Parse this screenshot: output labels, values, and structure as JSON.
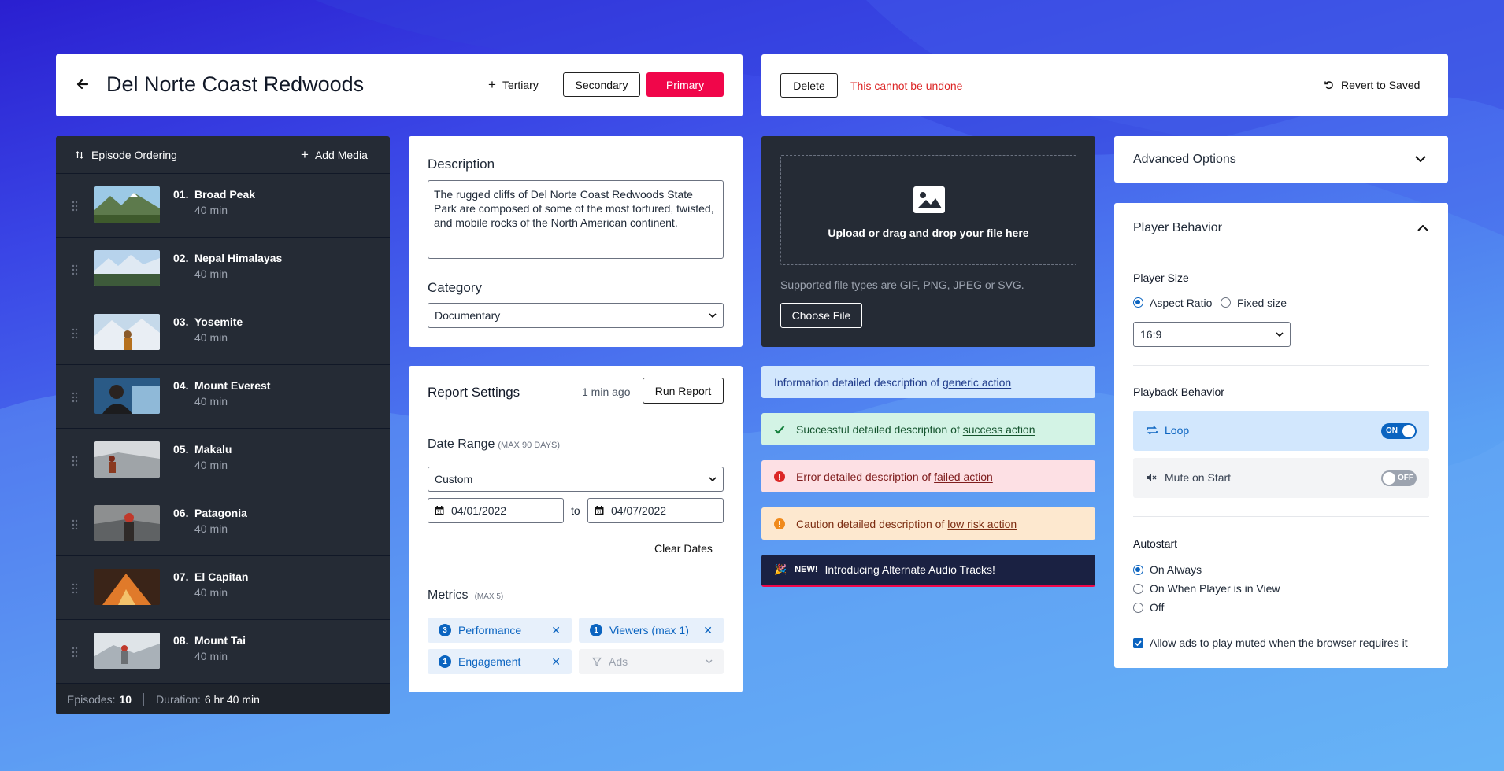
{
  "header": {
    "title": "Del Norte Coast Redwoods",
    "tertiary_label": "Tertiary",
    "secondary_label": "Secondary",
    "primary_label": "Primary"
  },
  "danger_bar": {
    "delete_label": "Delete",
    "warning_text": "This cannot be undone",
    "revert_label": "Revert to Saved"
  },
  "episodes": {
    "ordering_label": "Episode Ordering",
    "add_media_label": "Add Media",
    "items": [
      {
        "num": "01.",
        "title": "Broad Peak",
        "duration": "40 min"
      },
      {
        "num": "02.",
        "title": "Nepal Himalayas",
        "duration": "40 min"
      },
      {
        "num": "03.",
        "title": "Yosemite",
        "duration": "40 min"
      },
      {
        "num": "04.",
        "title": "Mount Everest",
        "duration": "40 min"
      },
      {
        "num": "05.",
        "title": "Makalu",
        "duration": "40 min"
      },
      {
        "num": "06.",
        "title": "Patagonia",
        "duration": "40 min"
      },
      {
        "num": "07.",
        "title": "El Capitan",
        "duration": "40 min"
      },
      {
        "num": "08.",
        "title": "Mount Tai",
        "duration": "40 min"
      }
    ],
    "footer": {
      "episodes_label": "Episodes:",
      "episodes_value": "10",
      "duration_label": "Duration:",
      "duration_value": "6 hr 40 min"
    }
  },
  "description": {
    "label": "Description",
    "text": "The rugged cliffs of Del Norte Coast Redwoods State Park are composed of some of the most tortured, twisted, and mobile rocks of the North American continent.",
    "category_label": "Category",
    "category_value": "Documentary"
  },
  "report": {
    "title": "Report Settings",
    "time_ago": "1 min ago",
    "run_label": "Run Report",
    "date_range_label": "Date Range",
    "date_range_hint": "(MAX 90 DAYS)",
    "range_value": "Custom",
    "start_date": "04/01/2022",
    "to_label": "to",
    "end_date": "04/07/2022",
    "clear_label": "Clear Dates",
    "metrics_label": "Metrics",
    "metrics_hint": "(MAX 5)",
    "chips": [
      {
        "count": "3",
        "label": "Performance"
      },
      {
        "count": "1",
        "label": "Viewers (max 1)"
      },
      {
        "count": "1",
        "label": "Engagement"
      }
    ],
    "ads_placeholder": "Ads"
  },
  "upload": {
    "drop_text": "Upload or drag and drop your file here",
    "supported_text": "Supported file types are GIF, PNG, JPEG or SVG.",
    "choose_label": "Choose File"
  },
  "alerts": {
    "info": {
      "text": "Information detailed description of ",
      "link": "generic action"
    },
    "success": {
      "text": "Successful detailed description of ",
      "link": "success action"
    },
    "error": {
      "text": "Error detailed description of ",
      "link": "failed action"
    },
    "caution": {
      "text": "Caution detailed description of ",
      "link": "low risk action"
    },
    "news": {
      "badge": "NEW!",
      "text": "Introducing Alternate Audio Tracks!"
    }
  },
  "advanced": {
    "title": "Advanced Options"
  },
  "player": {
    "title": "Player Behavior",
    "size_label": "Player Size",
    "size_options": [
      "Aspect Ratio",
      "Fixed size"
    ],
    "ratio_value": "16:9",
    "playback_label": "Playback Behavior",
    "loop_label": "Loop",
    "loop_state": "ON",
    "mute_label": "Mute on Start",
    "mute_state": "OFF",
    "autostart_label": "Autostart",
    "autostart_options": [
      "On Always",
      "On When Player is in View",
      "Off"
    ],
    "ads_checkbox_label": "Allow ads to play muted when the browser requires it"
  },
  "colors": {
    "primary": "#f0064a",
    "accent_blue": "#0b64c0",
    "dark_panel": "#252b35",
    "error": "#dc2626"
  }
}
